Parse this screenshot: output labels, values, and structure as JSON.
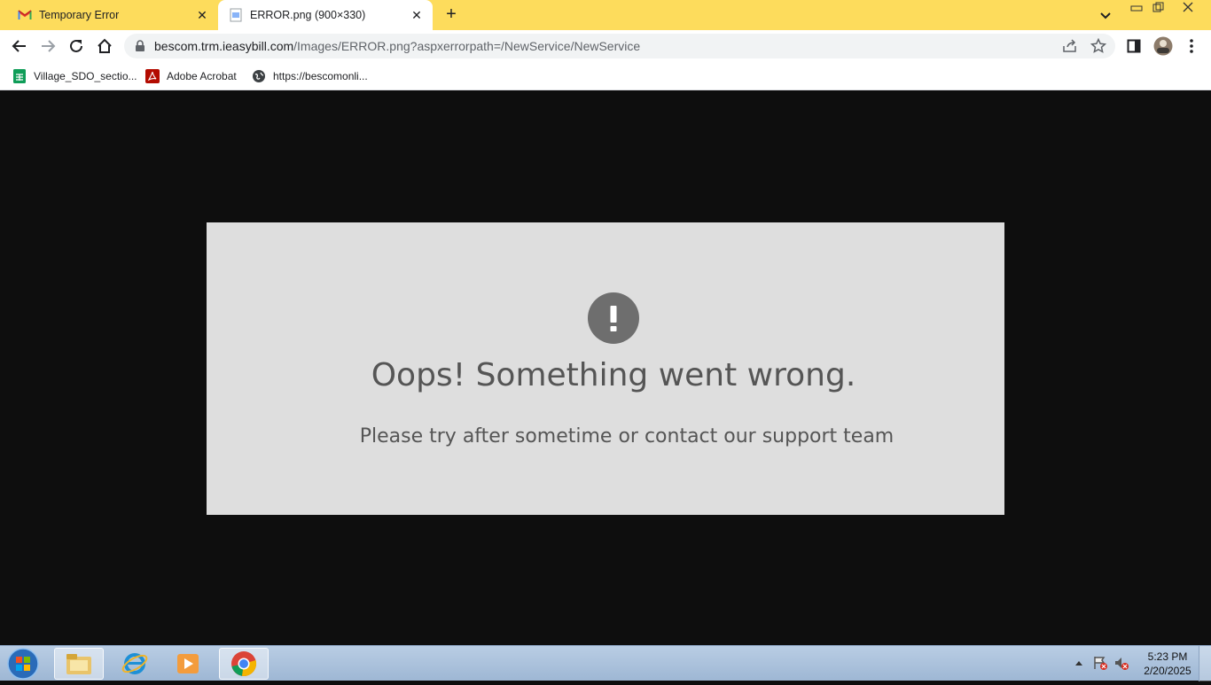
{
  "browser": {
    "tabs": [
      {
        "title": "Temporary Error",
        "icon": "gmail-icon"
      },
      {
        "title": "ERROR.png (900×330)",
        "icon": "image-file-icon",
        "active": true
      }
    ],
    "url": {
      "host": "bescom.trm.ieasybill.com",
      "path": "/Images/ERROR.png?aspxerrorpath=/NewService/NewService"
    },
    "bookmarks": [
      {
        "label": "Village_SDO_sectio...",
        "icon": "google-sheets-icon"
      },
      {
        "label": "Adobe Acrobat",
        "icon": "acrobat-icon"
      },
      {
        "label": "https://bescomonli...",
        "icon": "globe-icon"
      }
    ],
    "accent": "#fddc5c"
  },
  "error_image": {
    "title": "Oops! Something went wrong.",
    "message": "Please try after sometime or contact our support team",
    "background": "#dedede",
    "text_color": "#555555"
  },
  "taskbar": {
    "apps": [
      "file-explorer-icon",
      "internet-explorer-icon",
      "media-player-icon",
      "chrome-icon"
    ],
    "clock": {
      "time": "5:23 PM",
      "date": "2/20/2025"
    }
  }
}
